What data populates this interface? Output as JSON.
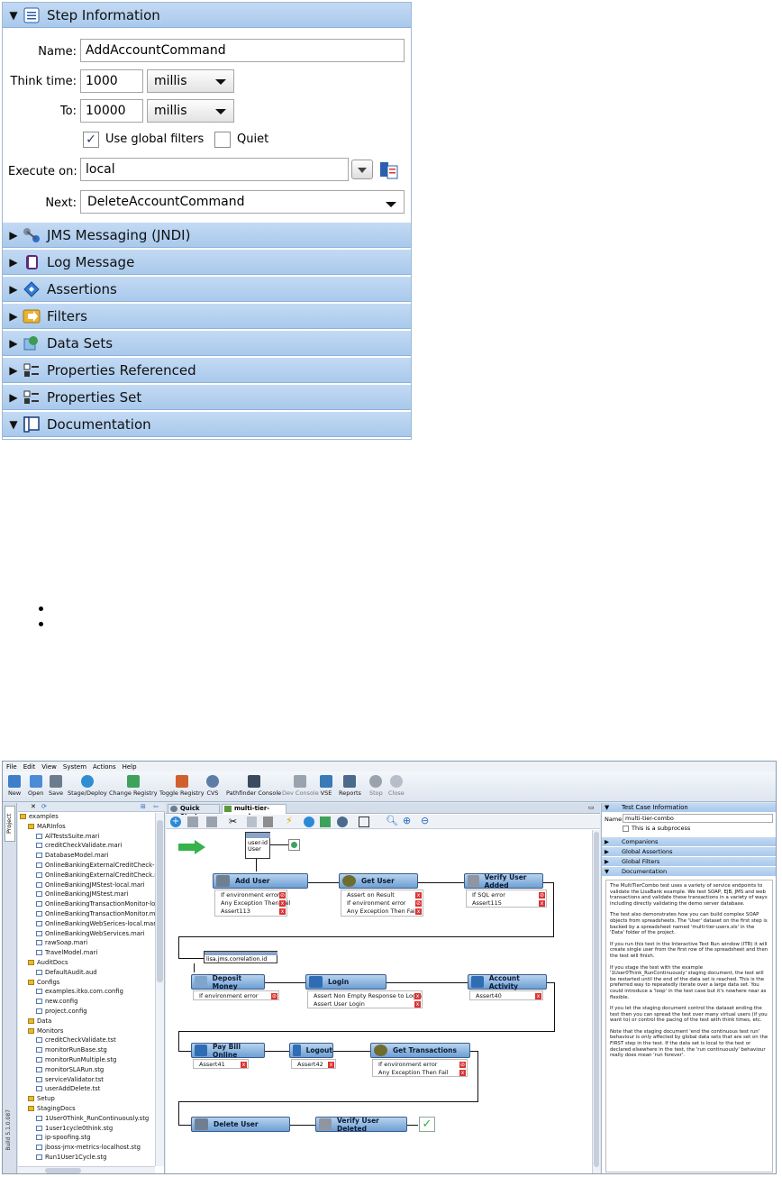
{
  "panel": {
    "header": "Step Information",
    "name_label": "Name:",
    "name_value": "AddAccountCommand",
    "think_label": "Think time:",
    "think_value": "1000",
    "think_unit": "millis",
    "to_label": "To:",
    "to_value": "10000",
    "to_unit": "millis",
    "global_filters_label": "Use global filters",
    "global_filters_checked": true,
    "quiet_label": "Quiet",
    "quiet_checked": false,
    "execute_label": "Execute on:",
    "execute_value": "local",
    "next_label": "Next:",
    "next_value": "DeleteAccountCommand",
    "sections": [
      "JMS Messaging (JNDI)",
      "Log Message",
      "Assertions",
      "Filters",
      "Data Sets",
      "Properties Referenced",
      "Properties Set",
      "Documentation"
    ]
  },
  "ide": {
    "menu": [
      "File",
      "Edit",
      "View",
      "System",
      "Actions",
      "Help"
    ],
    "toolbar": [
      "New",
      "Open",
      "Save",
      "Stage/Deploy",
      "Change Registry",
      "Toggle Registry",
      "CVS",
      "Pathfinder Console",
      "Dev Console",
      "VSE",
      "Reports",
      "Stop",
      "Close"
    ],
    "side_tab": "Project",
    "build": "Build 5.1.0.087",
    "tabs": [
      "Quick Start",
      "multi-tier-combo"
    ],
    "tree": [
      "examples",
      "MARInfos",
      "AllTestsSuite.mari",
      "creditCheckValidate.mari",
      "DatabaseModel.mari",
      "OnlineBankingExternalCreditCheck-lo",
      "OnlineBankingExternalCreditCheck.m",
      "OnlineBankingJMStest-local.mari",
      "OnlineBankingJMStest.mari",
      "OnlineBankingTransactionMonitor-loc",
      "OnlineBankingTransactionMonitor.ma",
      "OnlineBankingWebSerices-local.mari",
      "OnlineBankingWebServices.mari",
      "rawSoap.mari",
      "TravelModel.mari",
      "AuditDocs",
      "DefaultAudit.aud",
      "Configs",
      "examples.itko.com.config",
      "new.config",
      "project.config",
      "Data",
      "Monitors",
      "creditCheckValidate.tst",
      "monitorRunBase.stg",
      "monitorRunMultiple.stg",
      "monitorSLARun.stg",
      "serviceValidator.tst",
      "userAddDelete.tst",
      "Setup",
      "StagingDocs",
      "1User0Think_RunContinuously.stg",
      "1user1cycle0think.stg",
      "ip-spoofing.stg",
      "jboss-jmx-metrics-localhost.stg",
      "Run1User1Cycle.stg"
    ],
    "flow": {
      "start_property": "user-id",
      "start_property_sub": "User",
      "jms_property": "lisa.jms.correlation.id",
      "nodes": [
        {
          "name": "Add User",
          "assertions": [
            "If environment error",
            "Any Exception Then Fail",
            "Assert113"
          ]
        },
        {
          "name": "Get User",
          "assertions": [
            "Assert on Result",
            "If environment error",
            "Any Exception Then Fail"
          ]
        },
        {
          "name": "Verify User Added",
          "assertions": [
            "If SQL error",
            "Assert115"
          ]
        },
        {
          "name": "Deposit Money",
          "assertions": [
            "If environment error"
          ]
        },
        {
          "name": "Login",
          "assertions": [
            "Assert Non Empty Response to Login",
            "Assert User Login"
          ]
        },
        {
          "name": "Account Activity",
          "assertions": [
            "Assert40"
          ]
        },
        {
          "name": "Pay Bill Online",
          "assertions": [
            "Assert41"
          ]
        },
        {
          "name": "Logout",
          "assertions": [
            "Assert42"
          ]
        },
        {
          "name": "Get Transactions",
          "assertions": [
            "If environment error",
            "Any Exception Then Fail"
          ]
        },
        {
          "name": "Delete User",
          "assertions": []
        },
        {
          "name": "Verify User Deleted",
          "assertions": []
        }
      ]
    },
    "right": {
      "header": "Test Case Information",
      "name_label": "Name:",
      "name_value": "multi-tier-combo",
      "subprocess": "This is a subprocess",
      "sections": [
        "Companions",
        "Global Assertions",
        "Global Filters",
        "Documentation"
      ],
      "doc": [
        "The MultiTierCombo test uses a variety of service endpoints to validate the LisaBank example. We test SOAP, EJB, JMS and web transactions and validate these transactions in a variety of ways including directly validating the demo server database.",
        "The test also demonstrates how you can build complex SOAP objects from spreadsheets. The 'User' dataset on the first step is backed by a spreadsheet named 'multi-tier-users.xls' in the 'Data' folder of the project.",
        "If you run this test in the Interactive Test Run window (ITR) it will create single user from the first row of the spreadsheet and then the test will finish.",
        "If you stage the test with the example '1User0Think_RunContinuously' staging document, the test will be restarted until the end of the data set is reached. This is the preferred way to repeatedly iterate over a large data set. You could introduce a 'loop' in the test case but it's nowhere near as flexible.",
        "If you let the staging document control the dataset ending the test then you can spread the test over many virtual users (if you want to) or control the pacing of the test with think times, etc.",
        "Note that the staging document 'end the continuous test run' behaviour is only affected by global data sets that are set on the FIRST step in the test. If the data set is local to the test or declared elsewhere in the test, the 'run continuously' behaviour really does mean 'run forever'."
      ]
    }
  }
}
